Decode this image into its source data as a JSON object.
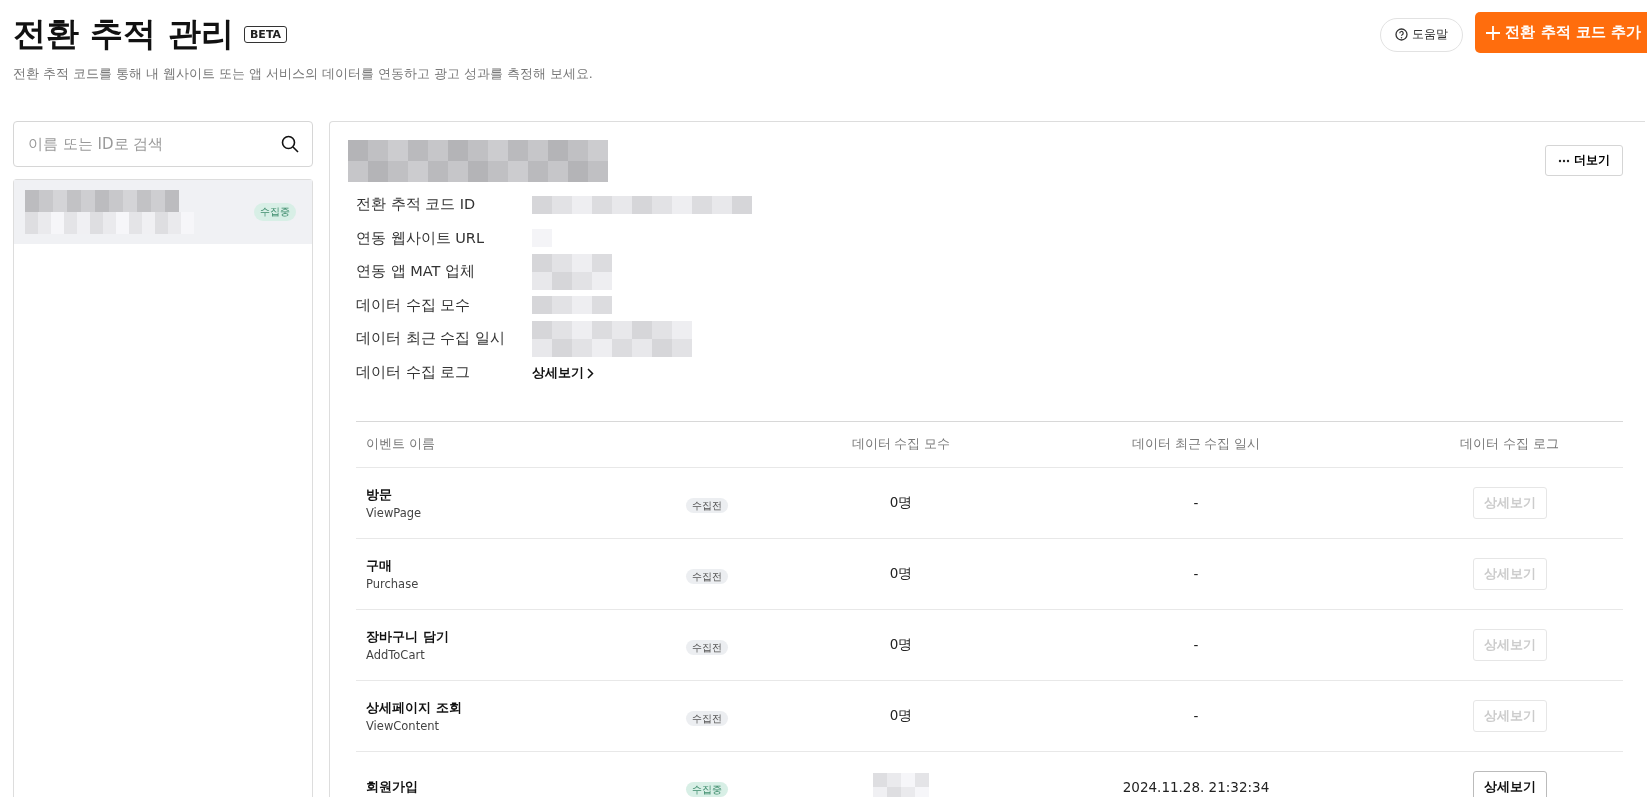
{
  "header": {
    "title": "전환 추적 관리",
    "badge": "BETA",
    "description": "전환 추적 코드를 통해 내 웹사이트 또는 앱 서비스의 데이터를 연동하고 광고 성과를 측정해 보세요.",
    "help_button": "도움말",
    "add_button": "전환 추적 코드 추가"
  },
  "sidebar": {
    "search": {
      "placeholder": "이름 또는 ID로 검색"
    },
    "items": [
      {
        "name": {
          "kind": "redacted"
        },
        "status": "수집중",
        "collecting": true,
        "selected": true
      }
    ]
  },
  "detail": {
    "name": {
      "kind": "redacted"
    },
    "more_button": "더보기",
    "fields": [
      {
        "label": "전환 추적 코드 ID",
        "value": {
          "kind": "redacted"
        }
      },
      {
        "label": "연동 웹사이트 URL",
        "value": {
          "kind": "redacted"
        }
      },
      {
        "label": "연동 앱 MAT 업체",
        "value": {
          "kind": "redacted"
        }
      },
      {
        "label": "데이터 수집 모수",
        "value": {
          "kind": "redacted"
        }
      },
      {
        "label": "데이터 최근 수집 일시",
        "value": {
          "kind": "redacted"
        }
      },
      {
        "label": "데이터 수집 로그",
        "link": "상세보기"
      }
    ]
  },
  "events": {
    "columns": [
      "이벤트 이름",
      "데이터 수집 모수",
      "데이터 최근 수집 일시",
      "데이터 수집 로그"
    ],
    "rows": [
      {
        "name": "방문",
        "code": "ViewPage",
        "status": "수집전",
        "collecting": false,
        "count": "0명",
        "last": "-",
        "log_button": "상세보기",
        "disabled": true
      },
      {
        "name": "구매",
        "code": "Purchase",
        "status": "수집전",
        "collecting": false,
        "count": "0명",
        "last": "-",
        "log_button": "상세보기",
        "disabled": true
      },
      {
        "name": "장바구니 담기",
        "code": "AddToCart",
        "status": "수집전",
        "collecting": false,
        "count": "0명",
        "last": "-",
        "log_button": "상세보기",
        "disabled": true
      },
      {
        "name": "상세페이지 조회",
        "code": "ViewContent",
        "status": "수집전",
        "collecting": false,
        "count": "0명",
        "last": "-",
        "log_button": "상세보기",
        "disabled": true
      },
      {
        "name": "회원가입",
        "status": "수집중",
        "collecting": true,
        "count": {
          "kind": "redacted"
        },
        "last": "2024.11.28. 21:32:34",
        "log_button": "상세보기",
        "disabled": false
      }
    ]
  }
}
